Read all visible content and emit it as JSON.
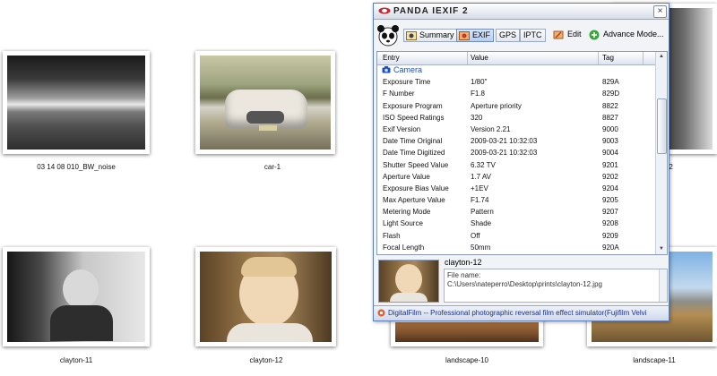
{
  "explorer": {
    "items": [
      {
        "caption": "03 14 08 010_BW_noise"
      },
      {
        "caption": "car-1"
      },
      {
        "caption": "clayton-11"
      },
      {
        "caption": "clayton-12"
      },
      {
        "caption": "landscape-10"
      },
      {
        "caption": "landscape-11"
      },
      {
        "caption": "n-2"
      }
    ]
  },
  "window": {
    "title": "PANDA IEXIF 2",
    "close_glyph": "×",
    "toolbar": {
      "summary": "Summary",
      "exif": "EXIF",
      "gps": "GPS",
      "iptc": "IPTC",
      "edit": "Edit",
      "advance": "Advance Mode..."
    },
    "table": {
      "headers": {
        "entry": "Entry",
        "value": "Value",
        "tag": "Tag"
      },
      "category": "Camera",
      "rows": [
        {
          "entry": "Exposure Time",
          "value": "1/80\"",
          "tag": "829A"
        },
        {
          "entry": "F Number",
          "value": "F1.8",
          "tag": "829D"
        },
        {
          "entry": "Exposure Program",
          "value": "Aperture priority",
          "tag": "8822"
        },
        {
          "entry": "ISO Speed Ratings",
          "value": "320",
          "tag": "8827"
        },
        {
          "entry": "Exif Version",
          "value": "Version 2.21",
          "tag": "9000"
        },
        {
          "entry": "Date Time Original",
          "value": "2009-03-21 10:32:03",
          "tag": "9003"
        },
        {
          "entry": "Date Time Digitized",
          "value": "2009-03-21 10:32:03",
          "tag": "9004"
        },
        {
          "entry": "Shutter Speed Value",
          "value": "6.32 TV",
          "tag": "9201"
        },
        {
          "entry": "Aperture Value",
          "value": "1.7 AV",
          "tag": "9202"
        },
        {
          "entry": "Exposure Bias Value",
          "value": "+1EV",
          "tag": "9204"
        },
        {
          "entry": "Max Aperture Value",
          "value": "F1.74",
          "tag": "9205"
        },
        {
          "entry": "Metering Mode",
          "value": "Pattern",
          "tag": "9207"
        },
        {
          "entry": "Light Source",
          "value": "Shade",
          "tag": "9208"
        },
        {
          "entry": "Flash",
          "value": "Off",
          "tag": "9209"
        },
        {
          "entry": "Focal Length",
          "value": "50mm",
          "tag": "920A"
        }
      ]
    },
    "info": {
      "name": "clayton-12",
      "file_label": "File name:",
      "file_path": "C:\\Users\\nateperro\\Desktop\\prints\\clayton-12.jpg"
    },
    "status": "DigitalFilm -- Professional photographic reversal film effect simulator(Fujifilm Velvi"
  }
}
